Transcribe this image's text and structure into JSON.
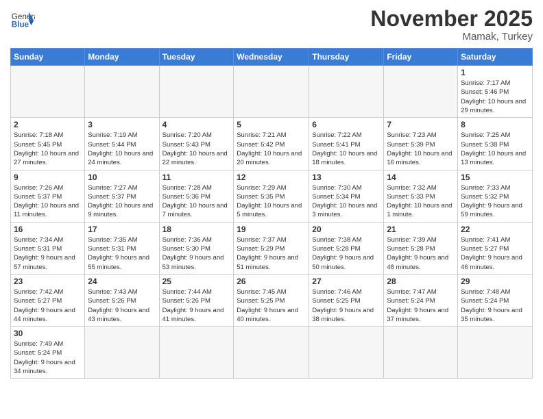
{
  "header": {
    "logo_general": "General",
    "logo_blue": "Blue",
    "month_title": "November 2025",
    "location": "Mamak, Turkey"
  },
  "days_of_week": [
    "Sunday",
    "Monday",
    "Tuesday",
    "Wednesday",
    "Thursday",
    "Friday",
    "Saturday"
  ],
  "weeks": [
    [
      {
        "day": "",
        "info": "",
        "empty": true
      },
      {
        "day": "",
        "info": "",
        "empty": true
      },
      {
        "day": "",
        "info": "",
        "empty": true
      },
      {
        "day": "",
        "info": "",
        "empty": true
      },
      {
        "day": "",
        "info": "",
        "empty": true
      },
      {
        "day": "",
        "info": "",
        "empty": true
      },
      {
        "day": "1",
        "info": "Sunrise: 7:17 AM\nSunset: 5:46 PM\nDaylight: 10 hours and 29 minutes."
      }
    ],
    [
      {
        "day": "2",
        "info": "Sunrise: 7:18 AM\nSunset: 5:45 PM\nDaylight: 10 hours and 27 minutes."
      },
      {
        "day": "3",
        "info": "Sunrise: 7:19 AM\nSunset: 5:44 PM\nDaylight: 10 hours and 24 minutes."
      },
      {
        "day": "4",
        "info": "Sunrise: 7:20 AM\nSunset: 5:43 PM\nDaylight: 10 hours and 22 minutes."
      },
      {
        "day": "5",
        "info": "Sunrise: 7:21 AM\nSunset: 5:42 PM\nDaylight: 10 hours and 20 minutes."
      },
      {
        "day": "6",
        "info": "Sunrise: 7:22 AM\nSunset: 5:41 PM\nDaylight: 10 hours and 18 minutes."
      },
      {
        "day": "7",
        "info": "Sunrise: 7:23 AM\nSunset: 5:39 PM\nDaylight: 10 hours and 16 minutes."
      },
      {
        "day": "8",
        "info": "Sunrise: 7:25 AM\nSunset: 5:38 PM\nDaylight: 10 hours and 13 minutes."
      }
    ],
    [
      {
        "day": "9",
        "info": "Sunrise: 7:26 AM\nSunset: 5:37 PM\nDaylight: 10 hours and 11 minutes."
      },
      {
        "day": "10",
        "info": "Sunrise: 7:27 AM\nSunset: 5:37 PM\nDaylight: 10 hours and 9 minutes."
      },
      {
        "day": "11",
        "info": "Sunrise: 7:28 AM\nSunset: 5:36 PM\nDaylight: 10 hours and 7 minutes."
      },
      {
        "day": "12",
        "info": "Sunrise: 7:29 AM\nSunset: 5:35 PM\nDaylight: 10 hours and 5 minutes."
      },
      {
        "day": "13",
        "info": "Sunrise: 7:30 AM\nSunset: 5:34 PM\nDaylight: 10 hours and 3 minutes."
      },
      {
        "day": "14",
        "info": "Sunrise: 7:32 AM\nSunset: 5:33 PM\nDaylight: 10 hours and 1 minute."
      },
      {
        "day": "15",
        "info": "Sunrise: 7:33 AM\nSunset: 5:32 PM\nDaylight: 9 hours and 59 minutes."
      }
    ],
    [
      {
        "day": "16",
        "info": "Sunrise: 7:34 AM\nSunset: 5:31 PM\nDaylight: 9 hours and 57 minutes."
      },
      {
        "day": "17",
        "info": "Sunrise: 7:35 AM\nSunset: 5:31 PM\nDaylight: 9 hours and 55 minutes."
      },
      {
        "day": "18",
        "info": "Sunrise: 7:36 AM\nSunset: 5:30 PM\nDaylight: 9 hours and 53 minutes."
      },
      {
        "day": "19",
        "info": "Sunrise: 7:37 AM\nSunset: 5:29 PM\nDaylight: 9 hours and 51 minutes."
      },
      {
        "day": "20",
        "info": "Sunrise: 7:38 AM\nSunset: 5:28 PM\nDaylight: 9 hours and 50 minutes."
      },
      {
        "day": "21",
        "info": "Sunrise: 7:39 AM\nSunset: 5:28 PM\nDaylight: 9 hours and 48 minutes."
      },
      {
        "day": "22",
        "info": "Sunrise: 7:41 AM\nSunset: 5:27 PM\nDaylight: 9 hours and 46 minutes."
      }
    ],
    [
      {
        "day": "23",
        "info": "Sunrise: 7:42 AM\nSunset: 5:27 PM\nDaylight: 9 hours and 44 minutes."
      },
      {
        "day": "24",
        "info": "Sunrise: 7:43 AM\nSunset: 5:26 PM\nDaylight: 9 hours and 43 minutes."
      },
      {
        "day": "25",
        "info": "Sunrise: 7:44 AM\nSunset: 5:26 PM\nDaylight: 9 hours and 41 minutes."
      },
      {
        "day": "26",
        "info": "Sunrise: 7:45 AM\nSunset: 5:25 PM\nDaylight: 9 hours and 40 minutes."
      },
      {
        "day": "27",
        "info": "Sunrise: 7:46 AM\nSunset: 5:25 PM\nDaylight: 9 hours and 38 minutes."
      },
      {
        "day": "28",
        "info": "Sunrise: 7:47 AM\nSunset: 5:24 PM\nDaylight: 9 hours and 37 minutes."
      },
      {
        "day": "29",
        "info": "Sunrise: 7:48 AM\nSunset: 5:24 PM\nDaylight: 9 hours and 35 minutes."
      }
    ],
    [
      {
        "day": "30",
        "info": "Sunrise: 7:49 AM\nSunset: 5:24 PM\nDaylight: 9 hours and 34 minutes."
      },
      {
        "day": "",
        "info": "",
        "empty": true
      },
      {
        "day": "",
        "info": "",
        "empty": true
      },
      {
        "day": "",
        "info": "",
        "empty": true
      },
      {
        "day": "",
        "info": "",
        "empty": true
      },
      {
        "day": "",
        "info": "",
        "empty": true
      },
      {
        "day": "",
        "info": "",
        "empty": true
      }
    ]
  ]
}
